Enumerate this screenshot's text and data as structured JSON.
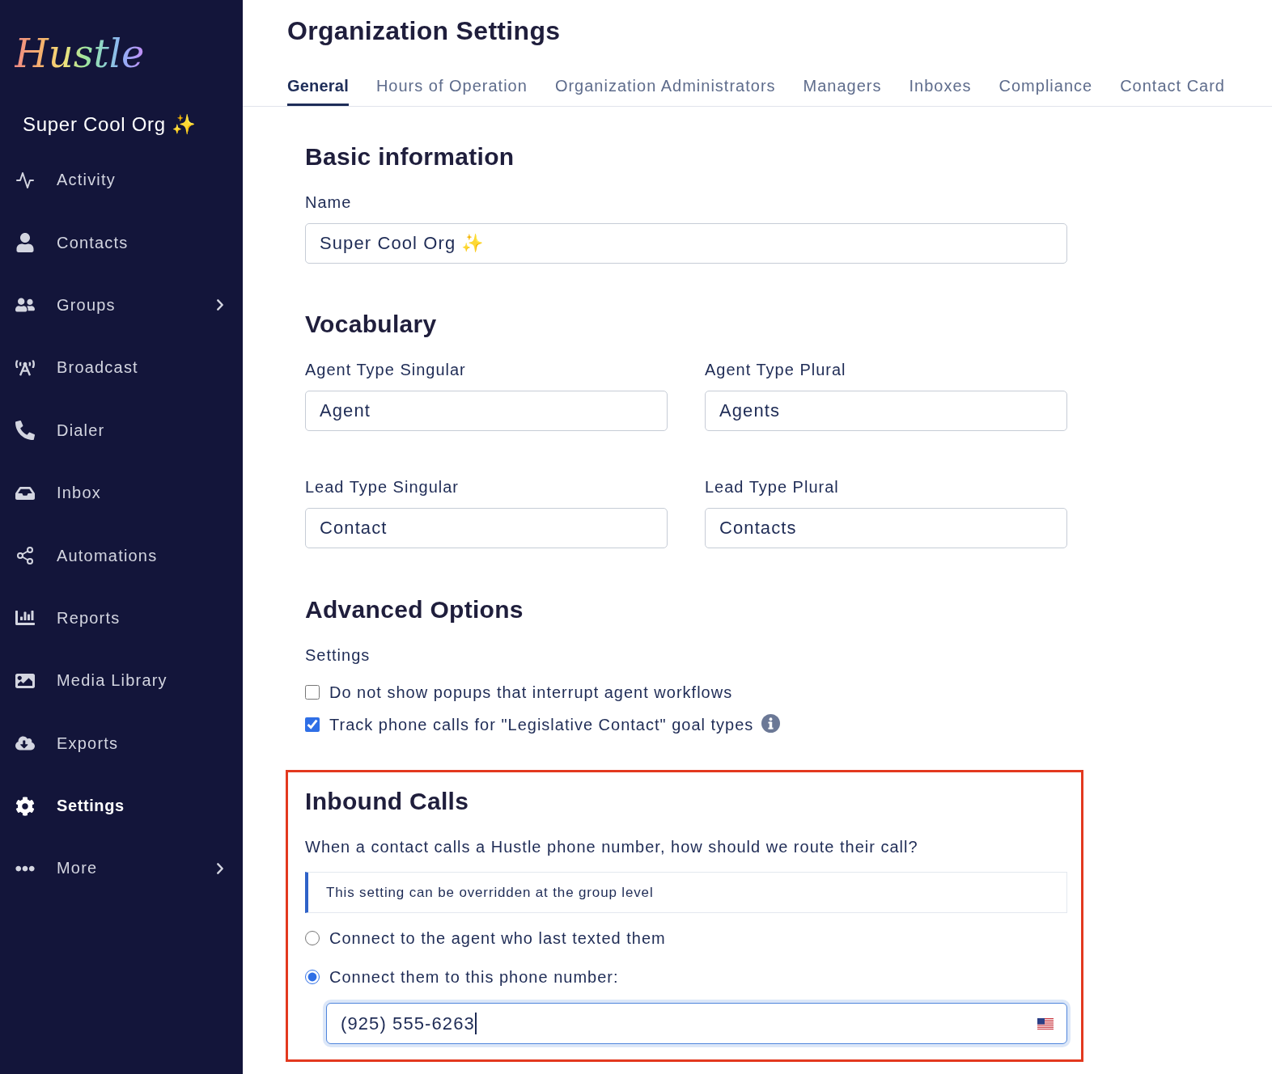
{
  "sidebar": {
    "logo": "Hustle",
    "org_name": "Super Cool Org ✨",
    "items": [
      {
        "label": "Activity",
        "selected": false,
        "has_submenu": false
      },
      {
        "label": "Contacts",
        "selected": false,
        "has_submenu": false
      },
      {
        "label": "Groups",
        "selected": false,
        "has_submenu": true
      },
      {
        "label": "Broadcast",
        "selected": false,
        "has_submenu": false
      },
      {
        "label": "Dialer",
        "selected": false,
        "has_submenu": false
      },
      {
        "label": "Inbox",
        "selected": false,
        "has_submenu": false
      },
      {
        "label": "Automations",
        "selected": false,
        "has_submenu": false
      },
      {
        "label": "Reports",
        "selected": false,
        "has_submenu": false
      },
      {
        "label": "Media Library",
        "selected": false,
        "has_submenu": false
      },
      {
        "label": "Exports",
        "selected": false,
        "has_submenu": false
      },
      {
        "label": "Settings",
        "selected": true,
        "has_submenu": false
      },
      {
        "label": "More",
        "selected": false,
        "has_submenu": true
      }
    ]
  },
  "page": {
    "title": "Organization Settings",
    "tabs": [
      {
        "label": "General",
        "selected": true
      },
      {
        "label": "Hours of Operation",
        "selected": false
      },
      {
        "label": "Organization Administrators",
        "selected": false
      },
      {
        "label": "Managers",
        "selected": false
      },
      {
        "label": "Inboxes",
        "selected": false
      },
      {
        "label": "Compliance",
        "selected": false
      },
      {
        "label": "Contact Card",
        "selected": false
      }
    ]
  },
  "basic_information": {
    "heading": "Basic information",
    "name": {
      "label": "Name",
      "value": "Super Cool Org ✨"
    }
  },
  "vocabulary": {
    "heading": "Vocabulary",
    "fields": [
      {
        "label": "Agent Type Singular",
        "value": "Agent"
      },
      {
        "label": "Agent Type Plural",
        "value": "Agents"
      },
      {
        "label": "Lead Type Singular",
        "value": "Contact"
      },
      {
        "label": "Lead Type Plural",
        "value": "Contacts"
      }
    ]
  },
  "advanced_options": {
    "heading": "Advanced Options",
    "settings_label": "Settings",
    "options": [
      {
        "label": "Do not show popups that interrupt agent workflows",
        "checked": false,
        "info": false
      },
      {
        "label": "Track phone calls for \"Legislative Contact\" goal types",
        "checked": true,
        "info": true
      }
    ]
  },
  "inbound_calls": {
    "highlighted": true,
    "heading": "Inbound Calls",
    "question": "When a contact calls a Hustle phone number, how should we route their call?",
    "note": "This setting can be overridden at the group level",
    "routes": [
      {
        "label": "Connect to the agent who last texted them",
        "selected": false
      },
      {
        "label": "Connect them to this phone number:",
        "selected": true
      }
    ],
    "phone_field": {
      "value": "(925) 555-6263",
      "focused": true
    }
  }
}
